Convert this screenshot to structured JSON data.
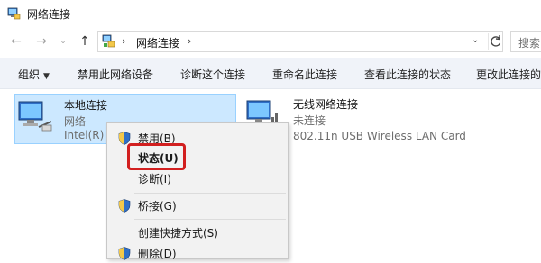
{
  "window": {
    "title": "网络连接"
  },
  "address": {
    "crumb": "网络连接",
    "search_placeholder": "搜索"
  },
  "commands": [
    "组织",
    "禁用此网络设备",
    "诊断这个连接",
    "重命名此连接",
    "查看此连接的状态",
    "更改此连接的设置"
  ],
  "items": [
    {
      "name": "本地连接",
      "line1": "网络",
      "line2": "Intel(R) 8"
    },
    {
      "name": "无线网络连接",
      "line1": "未连接",
      "line2": "802.11n USB Wireless LAN Card"
    }
  ],
  "context_menu": {
    "disable": "禁用(B)",
    "status": "状态(U)",
    "diagnose": "诊断(I)",
    "bridge": "桥接(G)",
    "shortcut": "创建快捷方式(S)",
    "delete": "删除(D)"
  },
  "colors": {
    "selection": "#cce8ff",
    "highlight_border": "#d21f1f",
    "command_bar": "#f0f3f9"
  }
}
